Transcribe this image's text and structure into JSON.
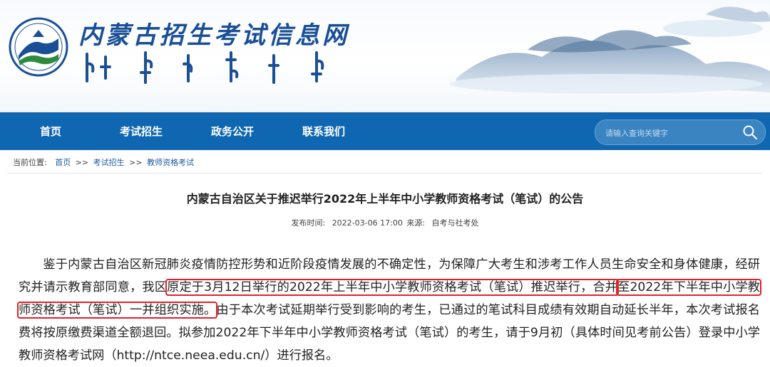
{
  "header": {
    "site_title": "内蒙古招生考试信息网",
    "colors": {
      "brand_blue": "#1a4f96",
      "nav_bg": "#0f67b1",
      "logo_green": "#2e8b3d"
    }
  },
  "nav": {
    "items": [
      "首页",
      "考试招生",
      "政务公开",
      "联系我们"
    ],
    "search_placeholder": "请输入查询关键字",
    "search_icon": "search-icon"
  },
  "breadcrumb": {
    "label": "当前位置:",
    "items": [
      "首页",
      "考试招生",
      "教师资格考试"
    ],
    "separator": ">>"
  },
  "article": {
    "title": "内蒙古自治区关于推迟举行2022年上半年中小学教师资格考试（笔试）的公告",
    "publish_label": "发布时间:",
    "publish_time": "2022-03-06 17:00",
    "source_label": "来源:",
    "source": "自考与社考处",
    "para_part1": "鉴于内蒙古自治区新冠肺炎疫情防控形势和近阶段疫情发展的不确定性，为保障广大考生和涉考工作人员生命安全和身体健康，经研究并请示教育部同意，我区",
    "para_highlight1": "原定于3月12日举行的2022年上半年中小学教师资格考试（笔试）推迟举行，合并",
    "para_highlight2": "至2022年下半年中小学教师资格考试（笔试）一并组织实施。",
    "para_part2": "由于本次考试延期举行受到影响的考生，已通过的笔试科目成绩有效期自动延长半年，本次考试报名费将按原缴费渠道全额退回。拟参加2022年下半年中小学教师资格考试（笔试）的考生，请于9月初（具体时间见考前公告）登录中小学教师资格考试网（http://ntce.neea.edu.cn/）进行报名。",
    "highlight_color": "#e0222a"
  }
}
